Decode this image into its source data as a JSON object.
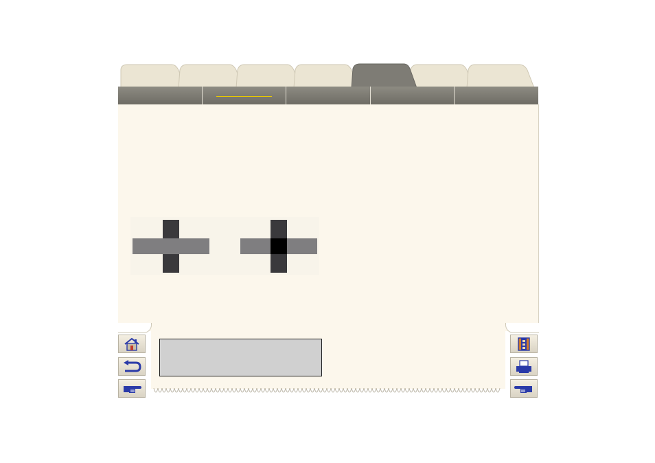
{
  "tabs": [
    {
      "label": "",
      "active": false
    },
    {
      "label": "",
      "active": false
    },
    {
      "label": "",
      "active": false
    },
    {
      "label": "",
      "active": false
    },
    {
      "label": "",
      "active": true
    },
    {
      "label": "",
      "active": false
    },
    {
      "label": "",
      "active": false
    }
  ],
  "subnav": [
    {
      "label": "",
      "active": false
    },
    {
      "label": "",
      "active": true
    },
    {
      "label": "",
      "active": false
    },
    {
      "label": "",
      "active": false
    },
    {
      "label": "",
      "active": false
    }
  ],
  "info_box": {
    "text": ""
  },
  "left_buttons": [
    {
      "icon": "home-icon"
    },
    {
      "icon": "back-arrow-icon"
    },
    {
      "icon": "pointing-hand-icon"
    }
  ],
  "right_buttons": [
    {
      "icon": "book-icon"
    },
    {
      "icon": "printer-icon"
    },
    {
      "icon": "pointing-hand-left-icon"
    }
  ],
  "colors": {
    "panel": "#fcf7ec",
    "tab_inactive": "#ebe5d3",
    "tab_active": "#7e7c75",
    "subnav": "#7a7870",
    "active_underline": "#e8c800",
    "info_box": "#d0d0d0",
    "cross_dark": "#3a393c",
    "cross_light": "#7f7e80",
    "cross_center": "#000000"
  }
}
